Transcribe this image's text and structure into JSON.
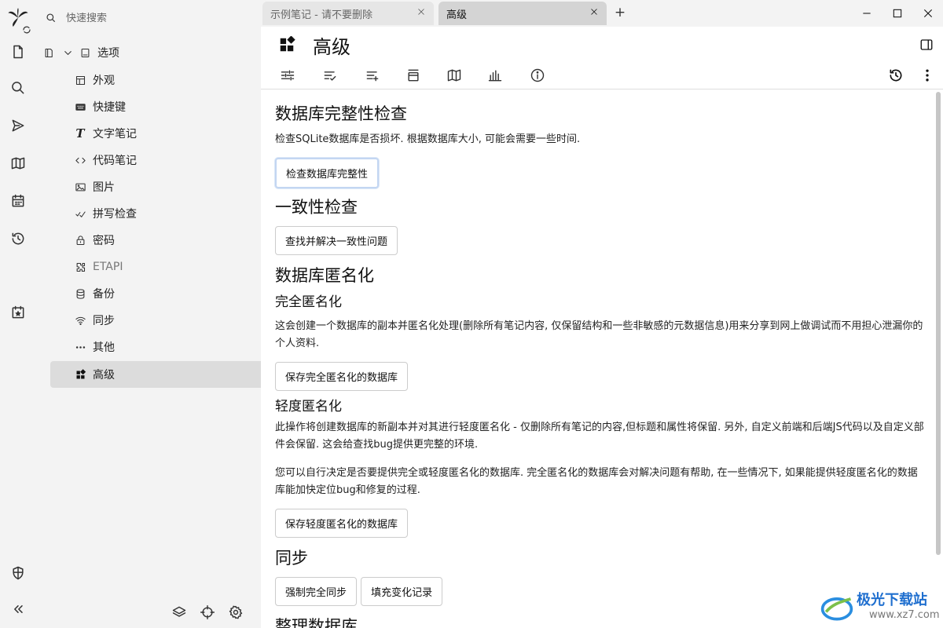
{
  "search": {
    "placeholder": "快速搜索"
  },
  "tree": {
    "root_label": "选项",
    "items": [
      {
        "label": "外观",
        "icon": "layout-icon"
      },
      {
        "label": "快捷键",
        "icon": "keyboard-icon"
      },
      {
        "label": "文字笔记",
        "icon": "text-icon"
      },
      {
        "label": "代码笔记",
        "icon": "code-icon"
      },
      {
        "label": "图片",
        "icon": "image-icon"
      },
      {
        "label": "拼写检查",
        "icon": "spellcheck-icon"
      },
      {
        "label": "密码",
        "icon": "lock-icon"
      },
      {
        "label": "ETAPI",
        "icon": "puzzle-icon"
      },
      {
        "label": "备份",
        "icon": "database-icon"
      },
      {
        "label": "同步",
        "icon": "wifi-icon"
      },
      {
        "label": "其他",
        "icon": "dots-icon"
      },
      {
        "label": "高级",
        "icon": "grid-icon"
      }
    ]
  },
  "tabs": [
    {
      "label": "示例笔记 - 请不要删除"
    },
    {
      "label": "高级"
    }
  ],
  "new_tab_label": "+",
  "note": {
    "title": "高级"
  },
  "content": {
    "integrity": {
      "title": "数据库完整性检查",
      "desc": "检查SQLite数据库是否损坏. 根据数据库大小, 可能会需要一些时间.",
      "button": "检查数据库完整性"
    },
    "consistency": {
      "title": "一致性检查",
      "button": "查找并解决一致性问题"
    },
    "anonymize": {
      "title": "数据库匿名化",
      "full_title": "完全匿名化",
      "full_desc": "这会创建一个数据库的副本并匿名化处理(删除所有笔记内容, 仅保留结构和一些非敏感的元数据信息)用来分享到网上做调试而不用担心泄漏你的个人资料.",
      "full_button": "保存完全匿名化的数据库",
      "light_title": "轻度匿名化",
      "light_desc": "此操作将创建数据库的新副本并对其进行轻度匿名化 - 仅删除所有笔记的内容,但标题和属性将保留. 另外, 自定义前端和后端JS代码以及自定义部件会保留. 这会给查找bug提供更完整的环境.",
      "choice_desc": "您可以自行决定是否要提供完全或轻度匿名化的数据库. 完全匿名化的数据库会对解决问题有帮助, 在一些情况下, 如果能提供轻度匿名化的数据库能加快定位bug和修复的过程.",
      "light_button": "保存轻度匿名化的数据库"
    },
    "sync": {
      "title": "同步",
      "force_button": "强制完全同步",
      "fill_button": "填充变化记录"
    },
    "vacuum": {
      "title": "整理数据库"
    }
  },
  "watermark": {
    "text": "极光下载站",
    "url": "www.xz7.com"
  }
}
